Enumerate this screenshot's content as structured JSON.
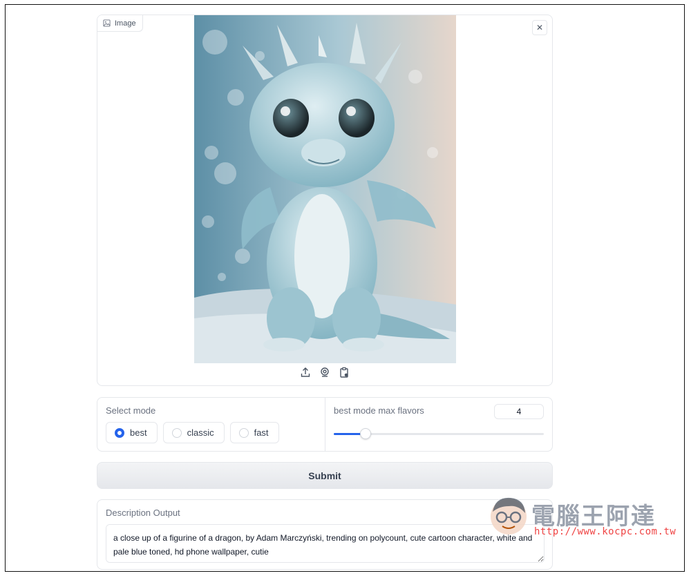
{
  "image_panel": {
    "label": "Image",
    "close_icon": "close-icon",
    "tools": [
      "upload-icon",
      "webcam-icon",
      "clipboard-icon"
    ]
  },
  "mode": {
    "label": "Select mode",
    "options": [
      "best",
      "classic",
      "fast"
    ],
    "selected": "best"
  },
  "flavors": {
    "label": "best mode max flavors",
    "value": "4",
    "slider_fraction": 0.15
  },
  "submit_label": "Submit",
  "output": {
    "label": "Description Output",
    "text": "a close up of a figurine of a dragon, by Adam Marczyński, trending on polycount, cute cartoon character, white and pale blue toned, hd phone wallpaper, cutie"
  },
  "watermark": {
    "title": "電腦王阿達",
    "url": "http://www.kocpc.com.tw"
  },
  "colors": {
    "accent": "#2563eb",
    "border": "#e5e7eb",
    "watermark_url": "#ef4444"
  }
}
